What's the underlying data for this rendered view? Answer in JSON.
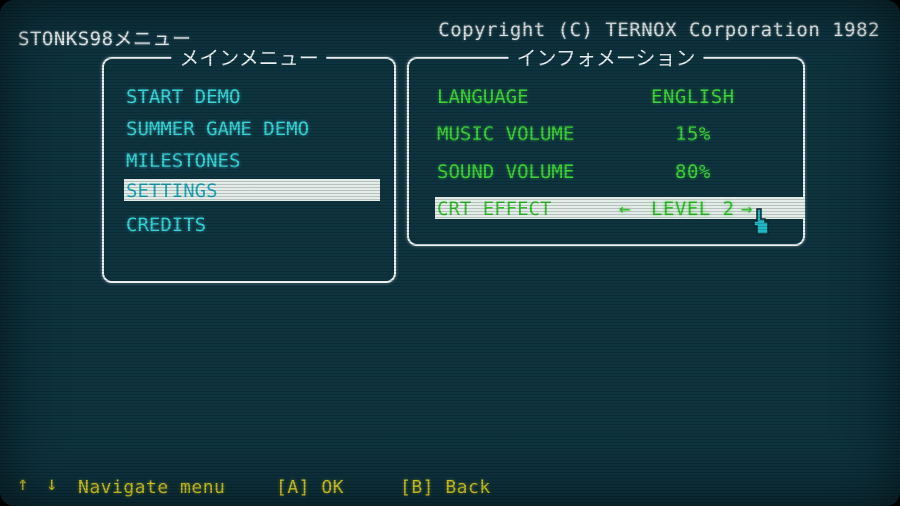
{
  "header": {
    "app_title": "STONKS98メニュー",
    "copyright": "Copyright (C) TERNOX Corporation 1982"
  },
  "main_menu": {
    "title": "メインメニュー",
    "items": [
      {
        "label": "START DEMO",
        "selected": false
      },
      {
        "label": "SUMMER GAME DEMO",
        "selected": false
      },
      {
        "label": "MILESTONES",
        "selected": false
      },
      {
        "label": "SETTINGS",
        "selected": true
      },
      {
        "label": "CREDITS",
        "selected": false
      }
    ]
  },
  "info_panel": {
    "title": "インフォメーション",
    "rows": [
      {
        "label": "LANGUAGE",
        "value": "ENGLISH",
        "selected": false
      },
      {
        "label": "MUSIC VOLUME",
        "value": "15%",
        "selected": false
      },
      {
        "label": "SOUND VOLUME",
        "value": "80%",
        "selected": false
      },
      {
        "label": "CRT EFFECT",
        "value": "LEVEL 2",
        "selected": true,
        "left_arrow": "←",
        "right_arrow": "→"
      }
    ]
  },
  "footer": {
    "up_arrow": "↑",
    "down_arrow": "↓",
    "navigate": "Navigate menu",
    "ok": "[A] OK",
    "back": "[B] Back"
  },
  "colors": {
    "background": "#0e3440",
    "menu_text": "#3ad4d8",
    "info_text": "#3fd23a",
    "footer_text": "#e6dc2a",
    "highlight": "#e2ece8"
  }
}
